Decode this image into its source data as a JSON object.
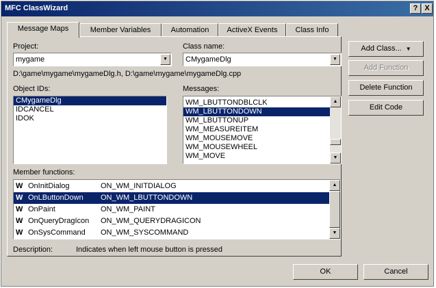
{
  "window": {
    "title": "MFC ClassWizard",
    "help_label": "?",
    "close_label": "X"
  },
  "tabs": [
    {
      "label": "Message Maps",
      "active": true
    },
    {
      "label": "Member Variables",
      "active": false
    },
    {
      "label": "Automation",
      "active": false
    },
    {
      "label": "ActiveX Events",
      "active": false
    },
    {
      "label": "Class Info",
      "active": false
    }
  ],
  "project": {
    "label": "Project:",
    "value": "mygame"
  },
  "class_name": {
    "label": "Class name:",
    "value": "CMygameDlg"
  },
  "files_text": "D:\\game\\mygame\\mygameDlg.h, D:\\game\\mygame\\mygameDlg.cpp",
  "object_ids": {
    "label": "Object IDs:",
    "items": [
      "CMygameDlg",
      "IDCANCEL",
      "IDOK"
    ],
    "selected_index": 0
  },
  "messages": {
    "label": "Messages:",
    "items": [
      "WM_LBUTTONDBLCLK",
      "WM_LBUTTONDOWN",
      "WM_LBUTTONUP",
      "WM_MEASUREITEM",
      "WM_MOUSEMOVE",
      "WM_MOUSEWHEEL",
      "WM_MOVE"
    ],
    "selected_index": 1
  },
  "member_functions": {
    "label": "Member functions:",
    "rows": [
      {
        "badge": "W",
        "name": "OnInitDialog",
        "message": "ON_WM_INITDIALOG"
      },
      {
        "badge": "W",
        "name": "OnLButtonDown",
        "message": "ON_WM_LBUTTONDOWN"
      },
      {
        "badge": "W",
        "name": "OnPaint",
        "message": "ON_WM_PAINT"
      },
      {
        "badge": "W",
        "name": "OnQueryDragIcon",
        "message": "ON_WM_QUERYDRAGICON"
      },
      {
        "badge": "W",
        "name": "OnSysCommand",
        "message": "ON_WM_SYSCOMMAND"
      }
    ],
    "selected_index": 1
  },
  "description": {
    "label": "Description:",
    "text": "Indicates when left mouse button is pressed"
  },
  "buttons": {
    "add_class": "Add Class...",
    "add_function": "Add Function",
    "delete_function": "Delete Function",
    "edit_code": "Edit Code",
    "ok": "OK",
    "cancel": "Cancel"
  },
  "colors": {
    "title_bar": "#0a246a",
    "selection": "#0a246a",
    "face": "#d4d0c8"
  }
}
